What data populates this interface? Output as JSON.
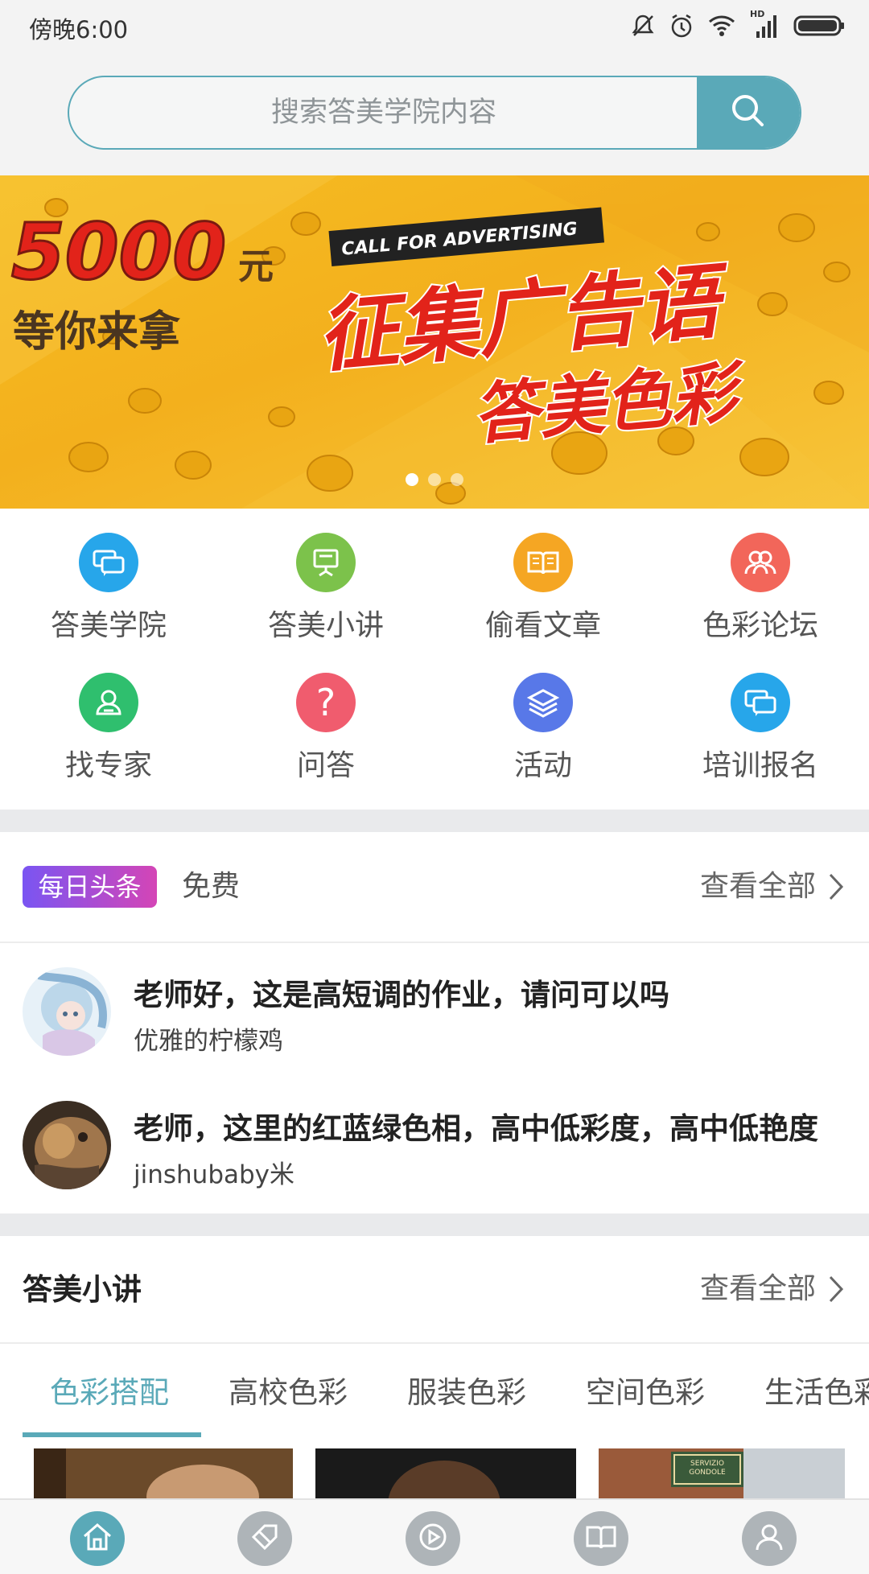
{
  "status_bar": {
    "time": "傍晚6:00",
    "network": "HD"
  },
  "search": {
    "placeholder": "搜索答美学院内容"
  },
  "banner": {
    "amount": "5000",
    "currency": "元",
    "subtitle": "等你来拿",
    "ribbon": "CALL FOR ADVERTISING",
    "headline": "征集广告语",
    "brand": "答美色彩",
    "slides": 3,
    "active_slide": 1
  },
  "grid": [
    {
      "label": "答美学院",
      "icon": "chat-icon",
      "color": "#27a6ea"
    },
    {
      "label": "答美小讲",
      "icon": "presentation-icon",
      "color": "#7cc24b"
    },
    {
      "label": "偷看文章",
      "icon": "book-icon",
      "color": "#f5a623"
    },
    {
      "label": "色彩论坛",
      "icon": "users-icon",
      "color": "#f2665a"
    },
    {
      "label": "找专家",
      "icon": "person-icon",
      "color": "#2fbf6e"
    },
    {
      "label": "问答",
      "icon": "question-icon",
      "color": "#f05c6e"
    },
    {
      "label": "活动",
      "icon": "layers-icon",
      "color": "#5878e8"
    },
    {
      "label": "培训报名",
      "icon": "chat-icon",
      "color": "#27a6ea"
    }
  ],
  "headlines": {
    "badge": "每日头条",
    "tag": "免费",
    "view_all": "查看全部",
    "posts": [
      {
        "title": "老师好，这是高短调的作业，请问可以吗",
        "author": "优雅的柠檬鸡"
      },
      {
        "title": "老师，这里的红蓝绿色相，高中低彩度，高中低艳度",
        "author": "jinshubaby米"
      }
    ]
  },
  "lectures": {
    "title": "答美小讲",
    "view_all": "查看全部",
    "tabs": [
      "色彩搭配",
      "高校色彩",
      "服装色彩",
      "空间色彩",
      "生活色彩"
    ],
    "active_tab": 0,
    "thumb_sign": "SERVIZIO GONDOLE"
  },
  "bottom_nav": [
    {
      "icon": "home-icon",
      "active": true
    },
    {
      "icon": "tag-icon",
      "active": false
    },
    {
      "icon": "play-icon",
      "active": false
    },
    {
      "icon": "book-icon",
      "active": false
    },
    {
      "icon": "profile-icon",
      "active": false
    }
  ],
  "colors": {
    "accent": "#5aa9b8",
    "banner": "#f3b01d",
    "active_nav": "#5aa9b8",
    "inactive_nav": "#aeb4b8"
  }
}
